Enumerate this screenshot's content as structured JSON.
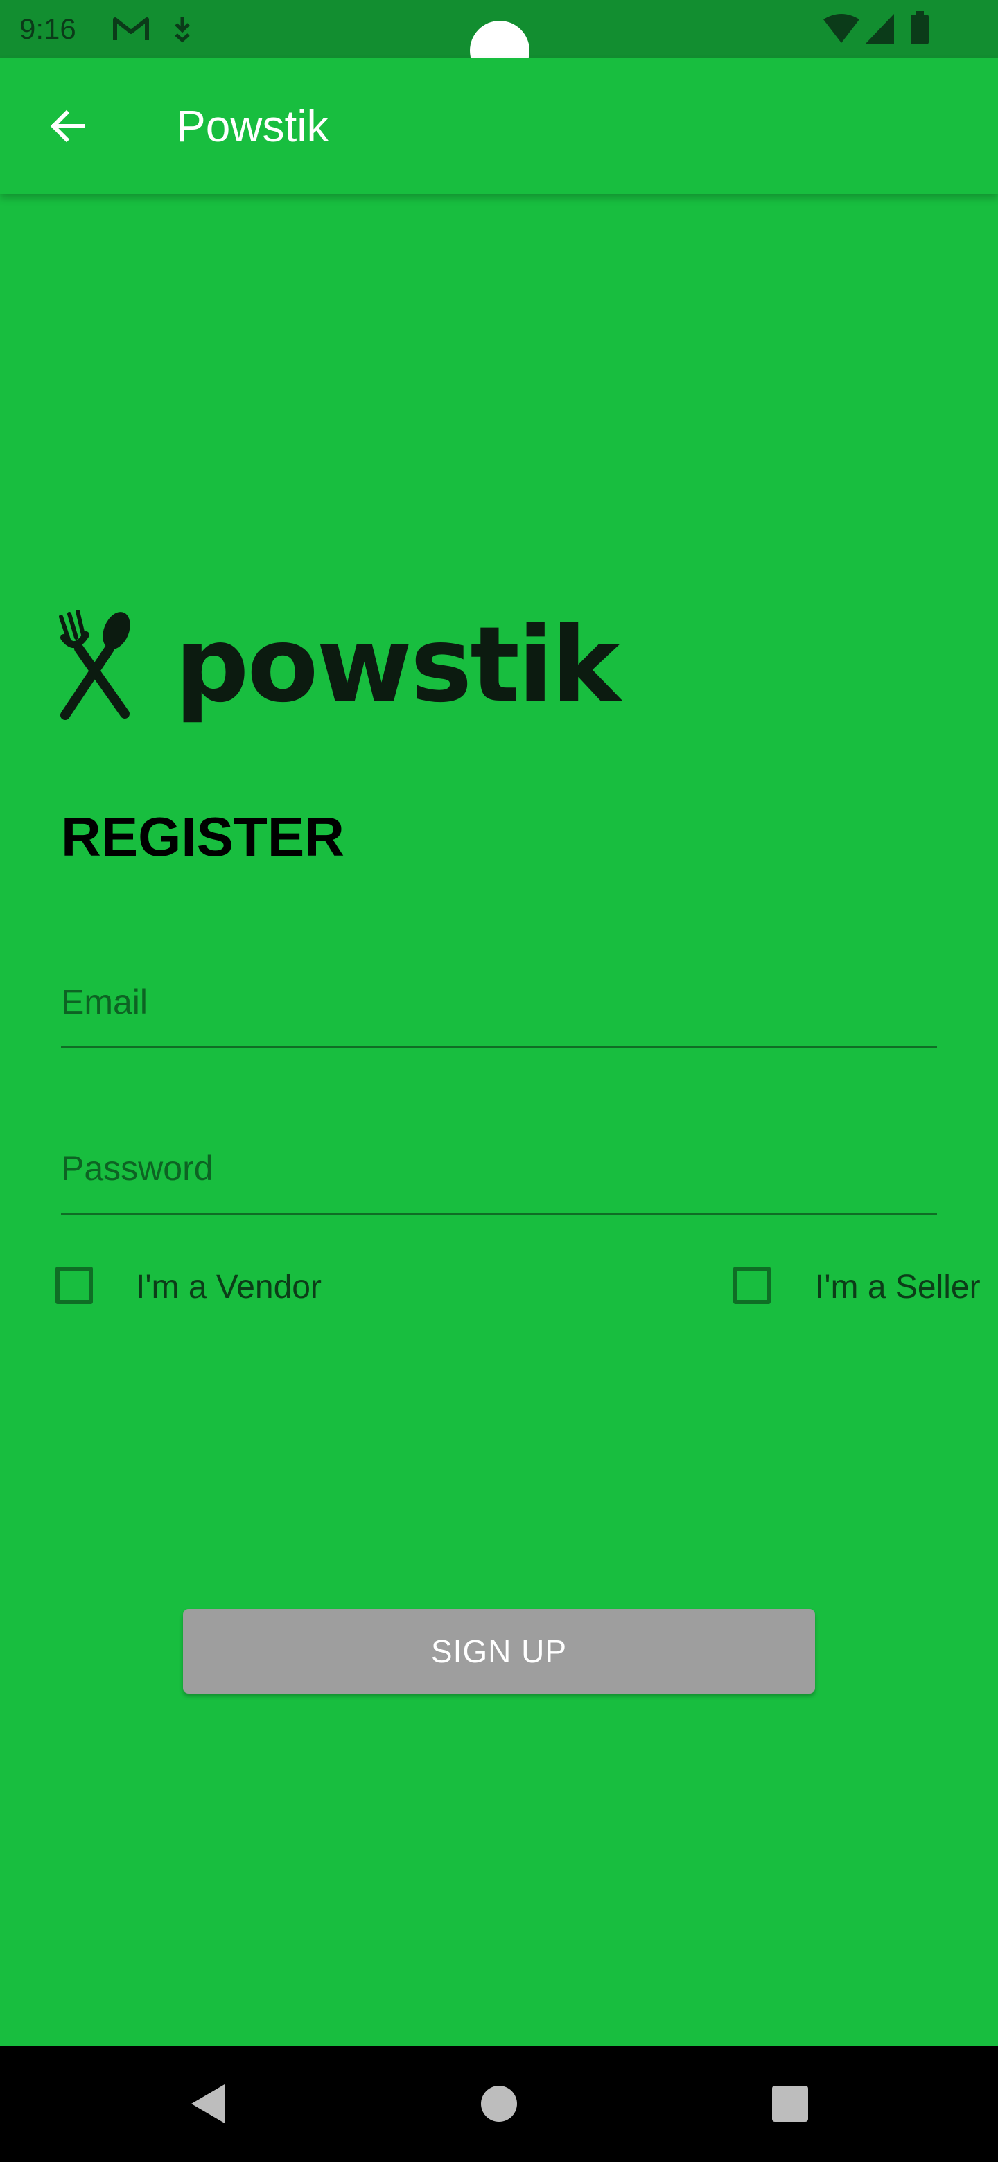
{
  "status_bar": {
    "time": "9:16",
    "icons": [
      "gmail-icon",
      "download-icon",
      "wifi-icon",
      "signal-icon",
      "battery-icon"
    ]
  },
  "app_bar": {
    "title": "Powstik",
    "back_icon": "arrow-left-icon"
  },
  "logo": {
    "text": "powstik",
    "icon": "fork-spoon-icon"
  },
  "form": {
    "heading": "REGISTER",
    "email_placeholder": "Email",
    "email_value": "",
    "password_placeholder": "Password",
    "password_value": "",
    "vendor_label": "I'm a Vendor",
    "vendor_checked": false,
    "seller_label": "I'm a Seller",
    "seller_checked": false,
    "signup_label": "SIGN UP"
  },
  "nav_bar": {
    "buttons": [
      "back-triangle-icon",
      "home-circle-icon",
      "recents-square-icon"
    ]
  },
  "colors": {
    "background": "#18be3f",
    "status_bar": "#128e30",
    "button_disabled": "#9e9e9e",
    "nav_bar": "#000000"
  }
}
